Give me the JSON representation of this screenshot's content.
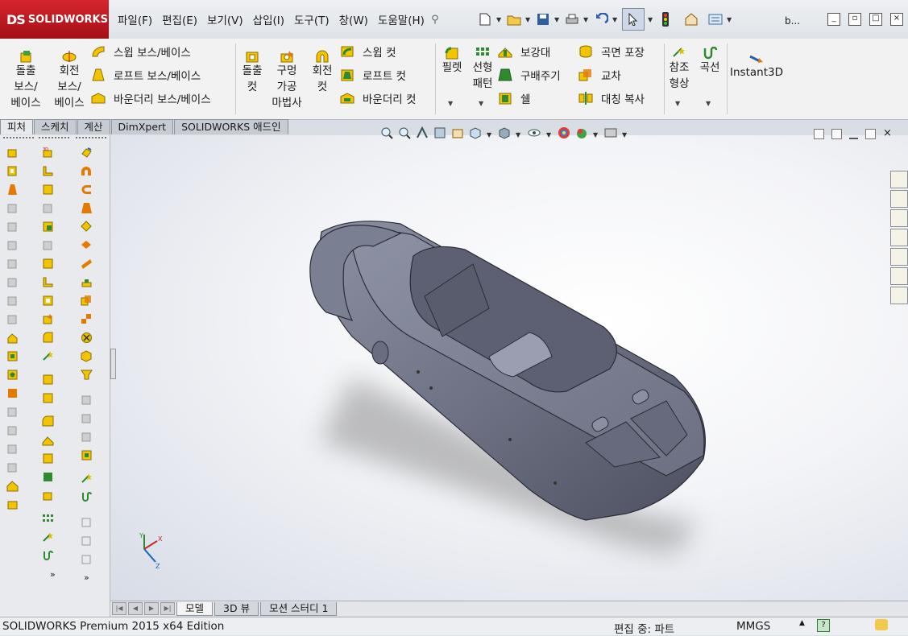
{
  "app": {
    "brand": "SOLIDWORKS",
    "brand_mark": "DS"
  },
  "menus": [
    "파일(F)",
    "편집(E)",
    "보기(V)",
    "삽입(I)",
    "도구(T)",
    "창(W)",
    "도움말(H)"
  ],
  "quick_access": {
    "user_label": "b..."
  },
  "ribbon": {
    "extrude_boss": "돌출\n보스/\n베이스",
    "revolve_boss": "회전\n보스/\n베이스",
    "sweep_boss": "스윕 보스/베이스",
    "loft_boss": "로프트 보스/베이스",
    "boundary_boss": "바운더리 보스/베이스",
    "extrude_cut": "돌출\n컷",
    "hole_wizard": "구멍\n가공\n마법사",
    "revolve_cut": "회전\n컷",
    "sweep_cut": "스윕 컷",
    "loft_cut": "로프트 컷",
    "boundary_cut": "바운더리 컷",
    "fillet": "필렛",
    "linear_pattern": "선형\n패턴",
    "rib": "보강대",
    "draft": "구배주기",
    "shell": "쉘",
    "wrap": "곡면 포장",
    "intersect": "교차",
    "mirror": "대칭 복사",
    "ref_geometry": "참조\n형상",
    "curves": "곡선",
    "instant3d": "Instant3D"
  },
  "tabs": [
    {
      "label": "피처",
      "active": true
    },
    {
      "label": "스케치",
      "active": false
    },
    {
      "label": "계산",
      "active": false
    },
    {
      "label": "DimXpert",
      "active": false
    },
    {
      "label": "SOLIDWORKS 애드인",
      "active": false
    }
  ],
  "bottom_tabs": [
    {
      "label": "모델",
      "active": true
    },
    {
      "label": "3D 뷰",
      "active": false
    },
    {
      "label": "모션 스터디 1",
      "active": false
    }
  ],
  "status": {
    "edition": "SOLIDWORKS Premium 2015 x64 Edition",
    "mode": "편집 중: 파트",
    "units": "MMGS"
  },
  "colors": {
    "brand_red": "#c0141c",
    "body_gray": "#6e7284",
    "icon_yellow": "#f2c500",
    "icon_green": "#2f8a2f",
    "icon_orange": "#e57a00"
  },
  "triad": {
    "x": "X",
    "y": "Y",
    "z": "Z"
  }
}
